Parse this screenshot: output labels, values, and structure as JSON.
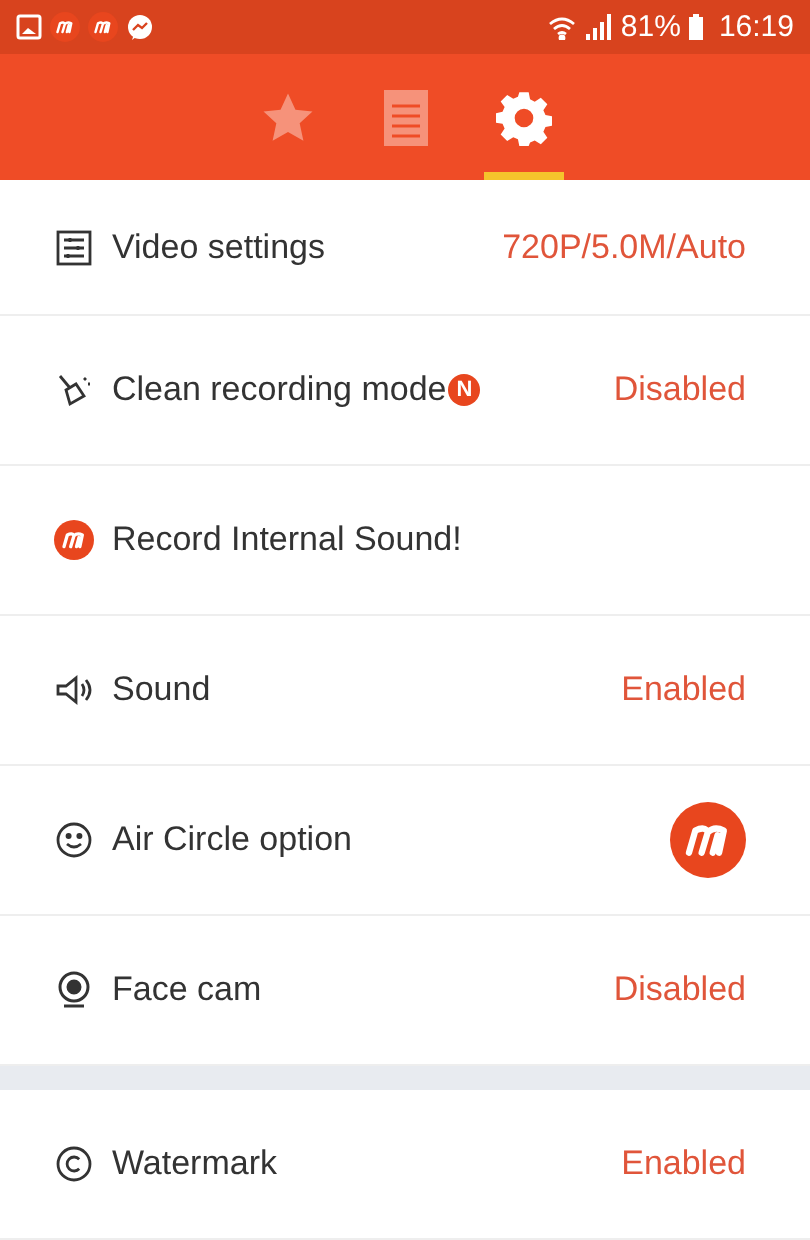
{
  "status_bar": {
    "battery_text": "81%",
    "time": "16:19"
  },
  "tabs": [
    {
      "kind": "star",
      "selected": false
    },
    {
      "kind": "list",
      "selected": false
    },
    {
      "kind": "gear",
      "selected": true
    }
  ],
  "sections": [
    {
      "items": [
        {
          "label": "Video settings",
          "value": "720P/5.0M/Auto"
        },
        {
          "label": "Clean recording mode",
          "badge": "N",
          "value": "Disabled"
        },
        {
          "label": "Record Internal Sound!"
        },
        {
          "label": "Sound",
          "value": "Enabled"
        },
        {
          "label": "Air Circle option",
          "kind": "logo"
        },
        {
          "label": "Face cam",
          "value": "Disabled"
        }
      ]
    },
    {
      "items": [
        {
          "label": "Watermark",
          "value": "Enabled"
        }
      ]
    }
  ]
}
